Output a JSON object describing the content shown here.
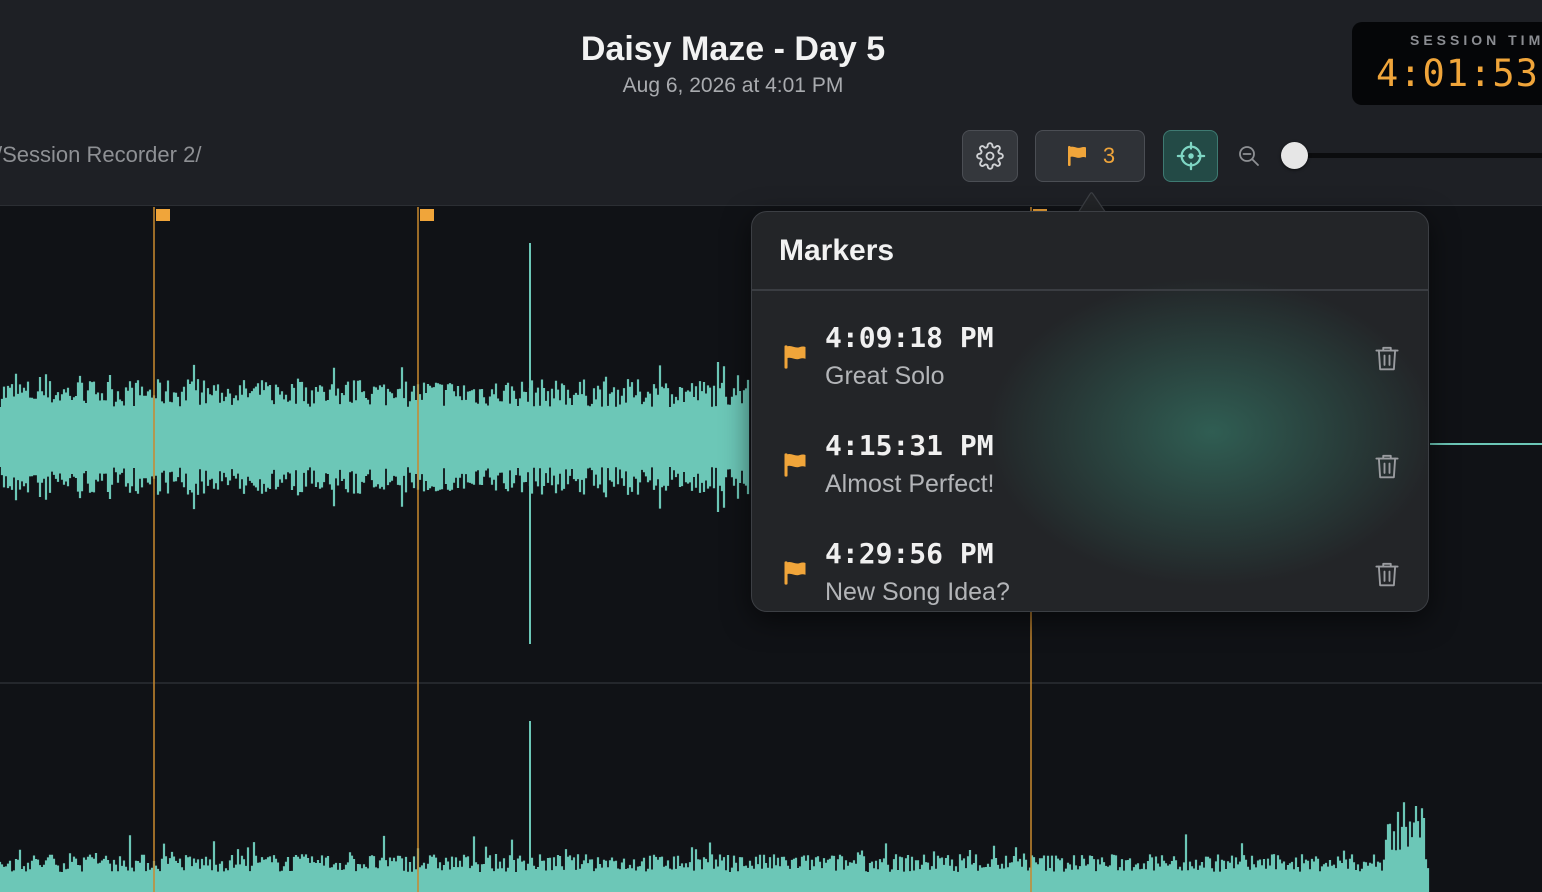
{
  "header": {
    "title": "Daisy Maze - Day 5",
    "date": "Aug 6, 2026 at 4:01 PM",
    "path": "/Session Recorder 2/"
  },
  "timer": {
    "label": "SESSION TIME",
    "value": "4:01:53"
  },
  "toolbar": {
    "settings_icon": "gear-icon",
    "markers_icon": "flag-icon",
    "markers_count": "3",
    "follow_icon": "crosshair-icon",
    "zoom_icon": "zoom-out-icon",
    "zoom_level": 0.0
  },
  "markers_popover": {
    "title": "Markers",
    "items": [
      {
        "time": "4:09:18 PM",
        "name": "Great Solo"
      },
      {
        "time": "4:15:31 PM",
        "name": "Almost Perfect!"
      },
      {
        "time": "4:29:56 PM",
        "name": "New Song Idea?"
      }
    ]
  },
  "colors": {
    "accent_orange": "#f0a53a",
    "waveform": "#6cc7b7",
    "background": "#101216",
    "header": "#1e2025"
  }
}
